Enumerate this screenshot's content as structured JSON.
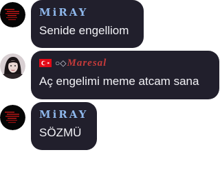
{
  "messages": [
    {
      "sender": "MiRAY",
      "text": "Senide engelliom"
    },
    {
      "sender_prefix": "○◇",
      "sender": "Maresal",
      "text": "Aç engelimi meme atcam sana"
    },
    {
      "sender": "MiRAY",
      "text": "SÖZMÜ"
    }
  ],
  "colors": {
    "bubble": "#211f2c",
    "miray_name": "#8fb8ec",
    "maresal_name": "#c43a3a",
    "flag_red": "#e30a17",
    "text": "#f2f2f6"
  },
  "icons": {
    "miray_avatar": "dark-avatar-with-red-text-icon",
    "maresal_avatar": "girl-portrait-avatar-icon",
    "maresal_flag": "turkey-flag-icon"
  }
}
